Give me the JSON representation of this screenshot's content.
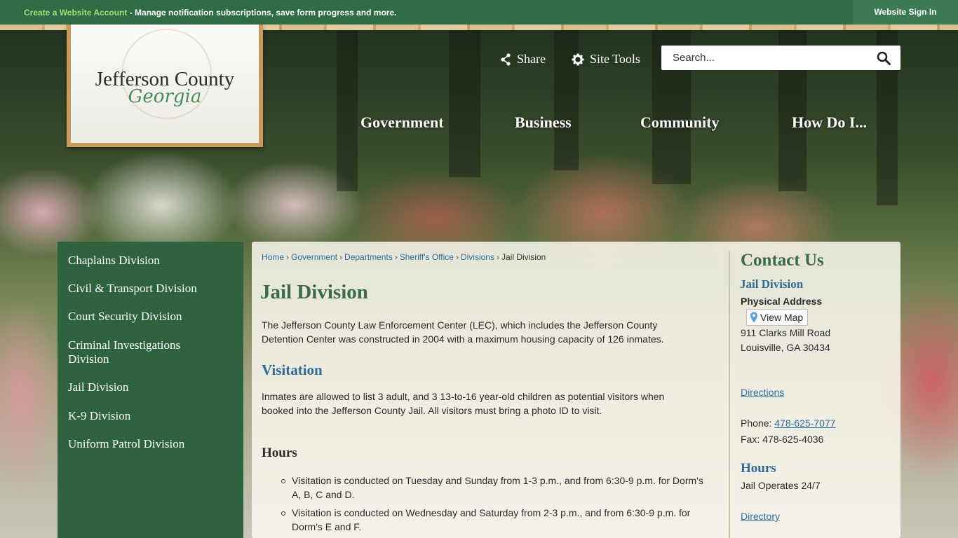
{
  "topbar": {
    "create_link": "Create a Website Account",
    "message": " - Manage notification subscriptions, save form progress and more.",
    "signin": "Website Sign In"
  },
  "logo": {
    "name": "Jefferson County",
    "script": "Georgia"
  },
  "header": {
    "share_label": "Share",
    "site_tools_label": "Site Tools",
    "search_placeholder": "Search..."
  },
  "nav": {
    "items": [
      "Government",
      "Business",
      "Community",
      "How Do I..."
    ]
  },
  "sidebar": {
    "items": [
      "Chaplains Division",
      "Civil & Transport Division",
      "Court Security Division",
      "Criminal Investigations Division",
      "Jail Division",
      "K-9 Division",
      "Uniform Patrol Division"
    ]
  },
  "breadcrumb": {
    "items": [
      "Home",
      "Government",
      "Departments",
      "Sheriff's Office",
      "Divisions"
    ],
    "current": "Jail Division"
  },
  "content": {
    "title": "Jail Division",
    "intro": "The Jefferson County Law Enforcement Center (LEC), which includes the Jefferson County Detention Center was constructed in 2004 with a maximum housing capacity of 126 inmates.",
    "visitation_heading": "Visitation",
    "visitation_text": "Inmates are allowed to list 3 adult, and 3 13-to-16 year-old children as potential visitors when booked into the Jefferson County Jail. All visitors must bring a photo ID to visit.",
    "hours_heading": "Hours",
    "hours_items": [
      "Visitation is conducted on Tuesday and Sunday from 1-3 p.m., and from 6:30-9 p.m. for Dorm's A, B, C and D.",
      "Visitation is conducted on Wednesday and Saturday from 2-3 p.m., and from 6:30-9 p.m. for Dorm's E and F."
    ]
  },
  "contact": {
    "title": "Contact Us",
    "name": "Jail Division",
    "address_label": "Physical Address",
    "view_map": "View Map",
    "address_line1": "911 Clarks Mill Road",
    "address_line2": "Louisville, GA 30434",
    "directions": "Directions",
    "phone_label": "Phone: ",
    "phone": "478-625-7077",
    "fax": "Fax: 478-625-4036",
    "hours_heading": "Hours",
    "hours_text": "Jail Operates 24/7",
    "directory": "Directory"
  },
  "colors": {
    "topbar": "#2f6b45",
    "accent_green": "#3a6b49",
    "link_blue": "#2d6f9e",
    "sidebar": "#2f6340"
  }
}
